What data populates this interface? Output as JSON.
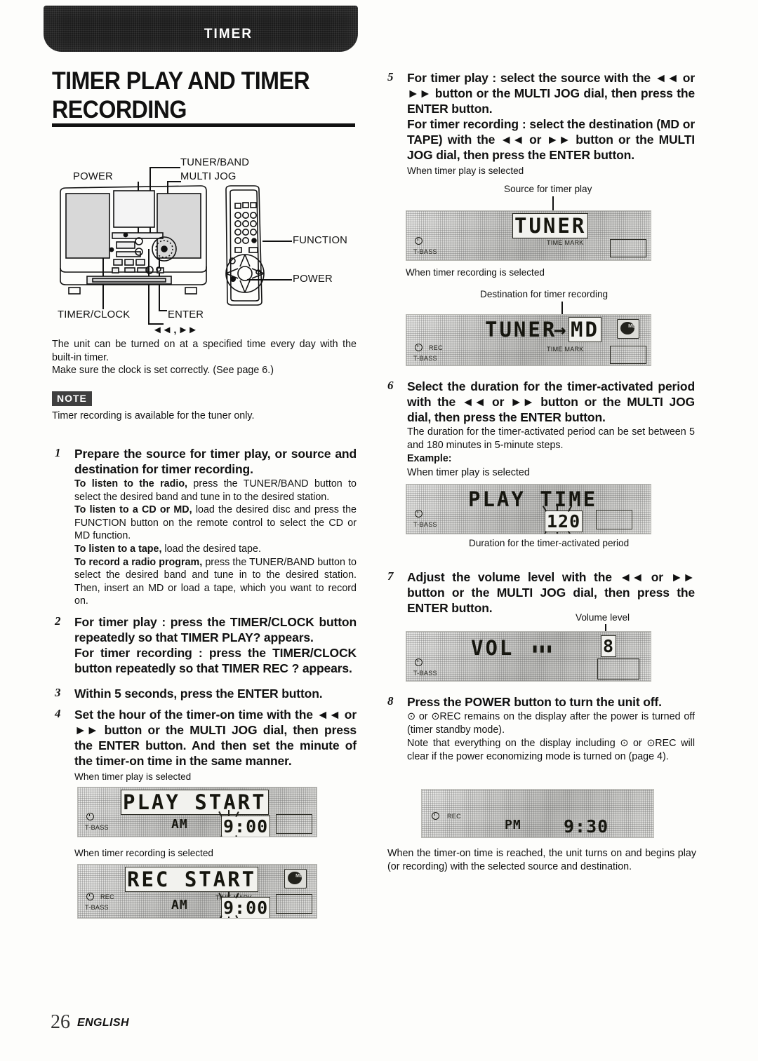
{
  "banner": {
    "tab_label": "TIMER"
  },
  "page_title": "TIMER PLAY AND TIMER RECORDING",
  "diagram": {
    "name": "stereo-system-and-remote",
    "labels": {
      "power_left": "POWER",
      "tuner_band": "TUNER/BAND",
      "multi_jog": "MULTI JOG",
      "function": "FUNCTION",
      "power_remote": "POWER",
      "timer_clock": "TIMER/CLOCK",
      "enter": "ENTER",
      "skip_buttons": "◄◄ , ►►"
    }
  },
  "intro": {
    "line1": "The unit can be turned on at a specified time every day with the built-in timer.",
    "line2": "Make sure the clock is set correctly. (See page 6.)"
  },
  "note": {
    "badge": "NOTE",
    "text": "Timer recording is available for the tuner only."
  },
  "steps": [
    {
      "num": "1",
      "head": "Prepare the source for timer play, or source and destination for timer recording.",
      "body": [
        {
          "bold": "To listen to the radio,",
          "rest": " press the TUNER/BAND button to select the desired band and tune in to the desired station."
        },
        {
          "bold": "To listen to a CD or MD,",
          "rest": " load the desired disc and press the FUNCTION button on the remote control to select the CD or MD function."
        },
        {
          "bold": "To listen to a tape,",
          "rest": " load the desired tape."
        },
        {
          "bold": "To record a radio program,",
          "rest": " press the TUNER/BAND button to select the desired band and tune in to the desired station. Then, insert an MD or load a tape, which you want to record on."
        }
      ]
    },
    {
      "num": "2",
      "head": "For timer play : press the TIMER/CLOCK button repeatedly so that TIMER PLAY? appears.",
      "head2": "For timer recording : press the TIMER/CLOCK button repeatedly so that TIMER REC ? appears."
    },
    {
      "num": "3",
      "head": "Within 5 seconds, press the ENTER button."
    },
    {
      "num": "4",
      "head": "Set the hour of the timer-on time with the ◄◄ or ►► button or  the MULTI JOG dial, then press the ENTER button.  And then set the minute of the timer-on time in the same manner.",
      "caption_play": "When timer play is selected",
      "caption_rec": "When timer recording is selected"
    },
    {
      "num": "5",
      "head": "For timer play : select the source with the ◄◄ or ►► button or  the MULTI JOG dial, then press the ENTER button.",
      "head2": "For timer recording : select the destination (MD or TAPE) with the ◄◄ or ►► button or  the MULTI JOG dial, then press the ENTER button.",
      "caption_play": "When timer play is selected",
      "caption_rec": "When timer recording is selected",
      "callout_source": "Source for timer play",
      "callout_destination": "Destination for timer recording"
    },
    {
      "num": "6",
      "head": "Select the duration for the timer-activated period with the ◄◄ or ►► button or  the MULTI JOG dial, then press the ENTER button.",
      "body": "The duration for the timer-activated period can be set between 5 and 180 minutes in 5-minute steps.",
      "example_label": "Example:",
      "caption_play": "When timer play is selected",
      "callout_duration": "Duration for the timer-activated period"
    },
    {
      "num": "7",
      "head": "Adjust the volume level with the ◄◄ or ►► button or  the MULTI JOG dial, then press the ENTER button.",
      "callout_volume": "Volume level"
    },
    {
      "num": "8",
      "head": "Press the POWER button to turn the unit off.",
      "body1": "⊙ or ⊙REC remains on the display after the power is turned off (timer standby mode).",
      "body2": "Note that everything on the display including ⊙ or ⊙REC will clear if the power economizing mode is turned on (page 4)."
    }
  ],
  "closing": "When the timer-on time is reached, the unit turns on and begins play (or recording) with the selected source and destination.",
  "displays": {
    "play_start": {
      "main": "PLAY START",
      "meridiem": "AM",
      "time": "9:00",
      "tbass": "T-BASS",
      "flashing": "9"
    },
    "rec_start": {
      "main": "REC START",
      "meridiem": "AM",
      "time": "9:00",
      "tbass": "T-BASS",
      "rec": "REC",
      "time_mark": "TIME MARK",
      "flashing": "9",
      "disc_icon": "md-disc-icon"
    },
    "tuner": {
      "main": "TUNER",
      "tbass": "T-BASS",
      "time_mark": "TIME MARK"
    },
    "tuner_md": {
      "main_left": "TUNER",
      "arrow": "→",
      "main_right": "MD",
      "tbass": "T-BASS",
      "rec": "REC",
      "time_mark": "TIME MARK",
      "disc_icon": "md-disc-icon"
    },
    "play_time": {
      "main": "PLAY TIME",
      "value": "120",
      "tbass": "T-BASS"
    },
    "vol": {
      "main": "VOL",
      "bars": "▮▮▮",
      "value": "8",
      "tbass": "T-BASS"
    },
    "standby": {
      "rec": "REC",
      "meridiem": "PM",
      "time": "9:30"
    }
  },
  "footer": {
    "page_number": "26",
    "language": "ENGLISH"
  }
}
